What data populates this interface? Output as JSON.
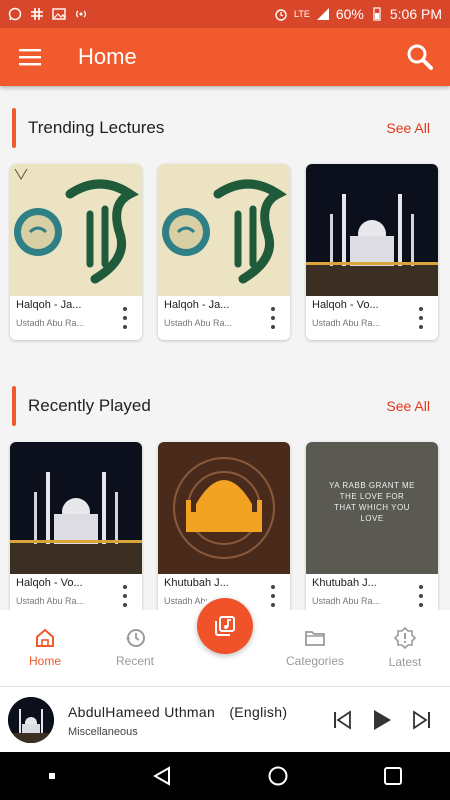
{
  "status_bar": {
    "battery": "60%",
    "time": "5:06 PM",
    "network": "LTE"
  },
  "app_bar": {
    "title": "Home",
    "menu_icon": "hamburger-icon",
    "search_icon": "search-icon"
  },
  "trending": {
    "title": "Trending Lectures",
    "see_all": "See All",
    "cards": [
      {
        "title": "Halqoh - Ja...",
        "subtitle": "Ustadh Abu Ra..."
      },
      {
        "title": "Halqoh - Ja...",
        "subtitle": "Ustadh Abu Ra..."
      },
      {
        "title": "Halqoh - Vo...",
        "subtitle": "Ustadh Abu Ra..."
      }
    ]
  },
  "recent": {
    "title": "Recently Played",
    "see_all": "See All",
    "cards": [
      {
        "title": "Halqoh - Vo...",
        "subtitle": "Ustadh Abu Ra..."
      },
      {
        "title": "Khutubah J...",
        "subtitle": "Ustadh Abu Ra..."
      },
      {
        "title": "Khutubah J...",
        "subtitle": "Ustadh Abu Ra...",
        "thumb_text": "YA RABB GRANT ME THE LOVE FOR THAT WHICH YOU LOVE"
      }
    ]
  },
  "bottom_nav": {
    "items": [
      {
        "label": "Home",
        "icon": "home-icon"
      },
      {
        "label": "Recent",
        "icon": "history-icon"
      },
      {
        "label": "Categories",
        "icon": "folder-icon"
      },
      {
        "label": "Latest",
        "icon": "badge-alert-icon"
      }
    ]
  },
  "player": {
    "title": "AbdulHameed Uthman　(English)",
    "subtitle": "Miscellaneous"
  },
  "colors": {
    "accent": "#f05a2c",
    "status_bar": "#d9472b",
    "link": "#e2381c"
  }
}
